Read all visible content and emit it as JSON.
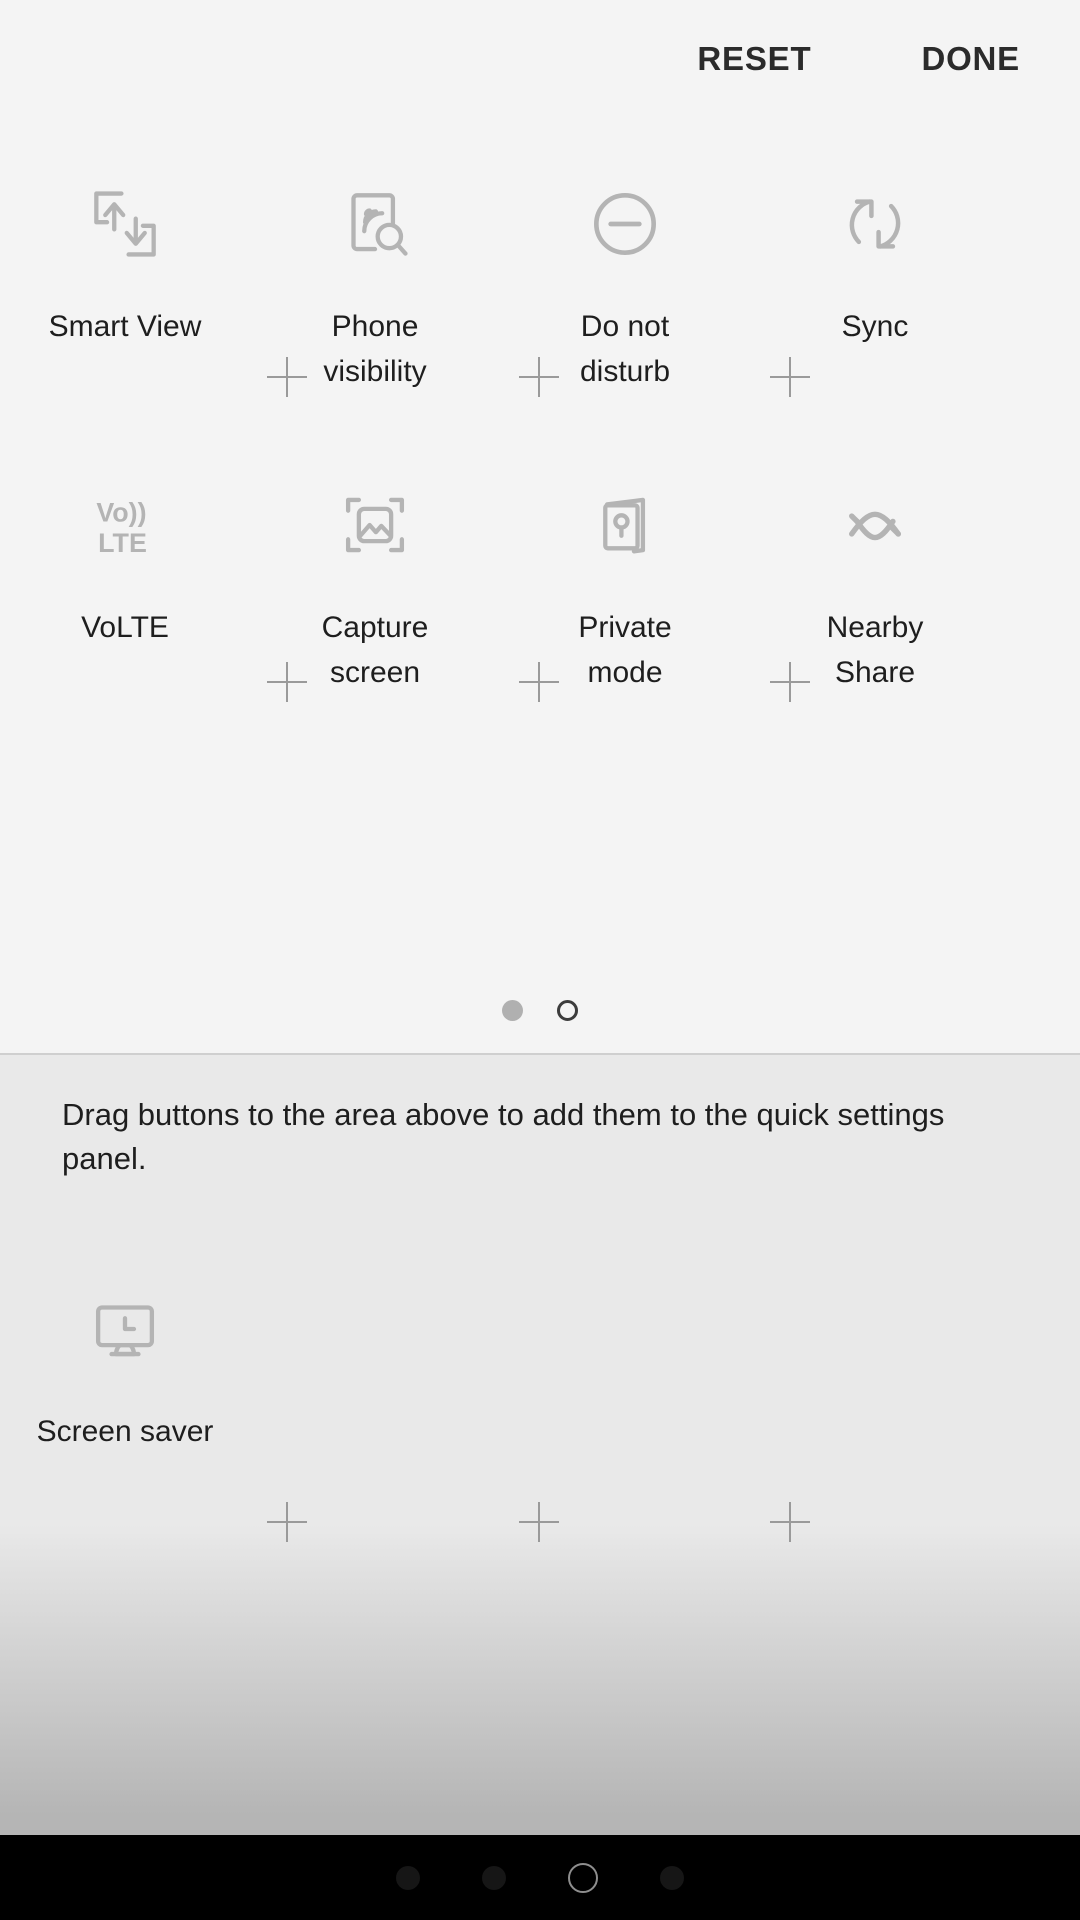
{
  "action_bar": {
    "reset_label": "RESET",
    "done_label": "DONE"
  },
  "grid": {
    "row1": [
      {
        "label": "Smart View",
        "icon": "smart-view-icon"
      },
      {
        "label": "Phone\nvisibility",
        "label_line1": "Phone",
        "label_line2": "visibility",
        "icon": "phone-visibility-icon"
      },
      {
        "label": "Do not\ndisturb",
        "label_line1": "Do not",
        "label_line2": "disturb",
        "icon": "do-not-disturb-icon"
      },
      {
        "label": "Sync",
        "icon": "sync-icon"
      }
    ],
    "row2": [
      {
        "label": "VoLTE",
        "icon": "volte-icon",
        "icon_text_top": "Vo))",
        "icon_text_bottom": "LTE"
      },
      {
        "label": "Capture\nscreen",
        "label_line1": "Capture",
        "label_line2": "screen",
        "icon": "capture-screen-icon"
      },
      {
        "label": "Private\nmode",
        "label_line1": "Private",
        "label_line2": "mode",
        "icon": "private-mode-icon"
      },
      {
        "label": "Nearby\nShare",
        "label_line1": "Nearby",
        "label_line2": "Share",
        "icon": "nearby-share-icon"
      }
    ]
  },
  "page_indicator": {
    "total": 2,
    "current": 2
  },
  "tray": {
    "instruction": "Drag buttons to the area above to add them to the quick settings panel.",
    "items": [
      {
        "label": "Screen saver",
        "icon": "screen-saver-icon"
      }
    ]
  },
  "nav_bar": {
    "dots": [
      "recents-dot",
      "back-dot",
      "home-circle",
      "extra-dot"
    ]
  },
  "colors": {
    "panel_top_bg": "#f4f4f4",
    "panel_bottom_bg": "#e9e9e9",
    "icon_gray": "#b4b4b4",
    "text_dark": "#1e1e1e",
    "action_text": "#2b2b2b",
    "plus_gray": "#9a9a9a",
    "divider": "#cfcfcf",
    "nav_bar_bg": "#000000"
  }
}
